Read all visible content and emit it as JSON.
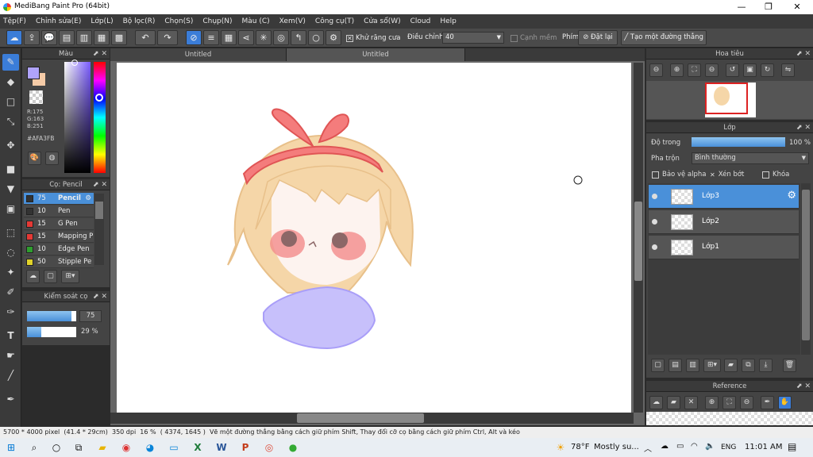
{
  "window": {
    "title": "MediBang Paint Pro (64bit)",
    "min": "—",
    "max": "❐",
    "close": "✕"
  },
  "menu": [
    "Tệp(F)",
    "Chỉnh sửa(E)",
    "Lớp(L)",
    "Bộ lọc(R)",
    "Chọn(S)",
    "Chụp(N)",
    "Màu (C)",
    "Xem(V)",
    "Công cụ(T)",
    "Cửa sổ(W)",
    "Cloud",
    "Help"
  ],
  "toolbar": {
    "antialias": "Khử răng cưa",
    "correction_label": "Điều chỉnh",
    "correction_value": "40",
    "soft_edge": "Cạnh mềm",
    "key_label": "Phím",
    "reset": "Đặt lại",
    "make_line": "Tạo một đường thẳng"
  },
  "color_panel": {
    "title": "Màu",
    "r": "R:175",
    "g": "G:163",
    "b": "B:251",
    "hex": "#AFA3FB",
    "primary": "#AFA3FB",
    "secondary": "#F5CBA7"
  },
  "brush_panel": {
    "title": "Cọ: Pencil",
    "brushes": [
      {
        "size": "75",
        "name": "Pencil",
        "color": "#333333"
      },
      {
        "size": "10",
        "name": "Pen",
        "color": "#333333"
      },
      {
        "size": "15",
        "name": "G Pen",
        "color": "#e53935"
      },
      {
        "size": "15",
        "name": "Mapping P",
        "color": "#e53935"
      },
      {
        "size": "10",
        "name": "Edge Pen",
        "color": "#2e9e2e"
      },
      {
        "size": "50",
        "name": "Stipple Pe",
        "color": "#e0d22a"
      }
    ]
  },
  "brush_control": {
    "title": "Kiểm soát cọ",
    "size": "75",
    "size_fill": 0.9,
    "opacity": "29 %",
    "opacity_fill": 0.29
  },
  "canvas": {
    "tab1": "Untitled",
    "tab2": "Untitled"
  },
  "navigator": {
    "title": "Hoa tiêu"
  },
  "layer_panel": {
    "title": "Lớp",
    "opacity_label": "Độ trong",
    "opacity_value": "100 %",
    "opacity_fill": 1.0,
    "blend_label": "Pha trộn",
    "blend_value": "Bình thường",
    "protect_alpha": "Bảo vệ alpha",
    "clipping": "Xén bớt",
    "lock": "Khóa",
    "layers": [
      {
        "name": "Lớp3",
        "selected": true
      },
      {
        "name": "Lớp2",
        "selected": false
      },
      {
        "name": "Lớp1",
        "selected": false
      }
    ]
  },
  "reference_panel": {
    "title": "Reference"
  },
  "status": {
    "size": "5700 * 4000 pixel",
    "cm": "(41.4 * 29cm)",
    "dpi": "350 dpi",
    "zoom": "16 %",
    "coords": "( 4374, 1645 )",
    "hint": "Vẽ một đường thẳng bằng cách giữ phím Shift, Thay đổi cỡ cọ bằng cách giữ phím Ctrl, Alt và kéo"
  },
  "taskbar": {
    "weather": "78°F",
    "weather_desc": "Mostly su...",
    "lang": "ENG",
    "time": "11:01 AM"
  }
}
